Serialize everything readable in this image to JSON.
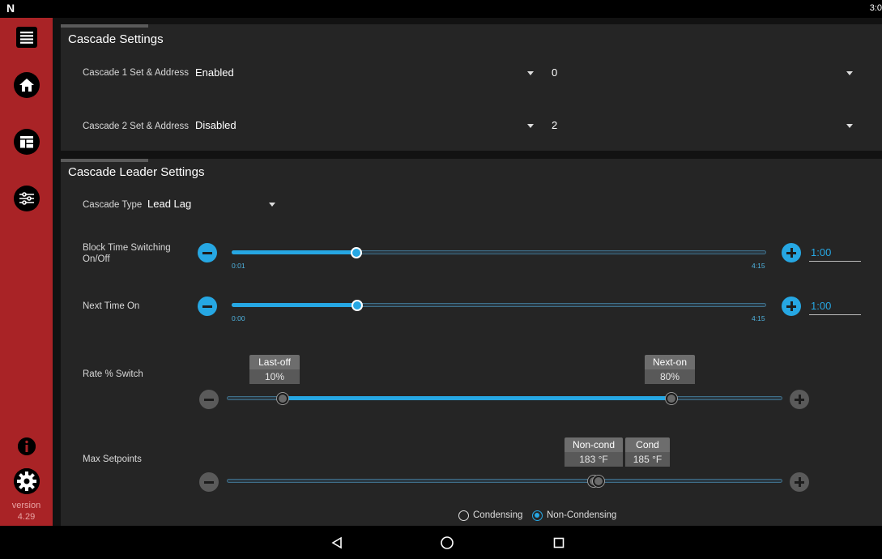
{
  "statusbar": {
    "logo": "N",
    "clock": "3:0"
  },
  "sidebar": {
    "items": [
      {
        "name": "menu",
        "icon": "hamburger-icon"
      },
      {
        "name": "home",
        "icon": "home-icon"
      },
      {
        "name": "dashboard",
        "icon": "dashboard-icon"
      },
      {
        "name": "settings-sliders",
        "icon": "sliders-icon"
      },
      {
        "name": "info",
        "icon": "info-icon"
      },
      {
        "name": "settings",
        "icon": "gear-icon"
      }
    ],
    "version_label": "version",
    "version_number": "4.29"
  },
  "cascade_settings": {
    "title": "Cascade Settings",
    "rows": [
      {
        "label": "Cascade 1 Set & Address",
        "value": "Enabled",
        "address": "0"
      },
      {
        "label": "Cascade 2 Set & Address",
        "value": "Disabled",
        "address": "2"
      }
    ]
  },
  "leader_settings": {
    "title": "Cascade Leader Settings",
    "cascade_type_label": "Cascade Type",
    "cascade_type_value": "Lead Lag",
    "block_time": {
      "label": "Block Time Switching On/Off",
      "min_label": "0:01",
      "max_label": "4:15",
      "value": "1:00",
      "fraction": 0.234
    },
    "next_time": {
      "label": "Next Time On",
      "min_label": "0:00",
      "max_label": "4:15",
      "value": "1:00",
      "fraction": 0.235
    },
    "rate_switch": {
      "label": "Rate % Switch",
      "low_title": "Last-off",
      "low_value": "10%",
      "high_title": "Next-on",
      "high_value": "80%",
      "low_fraction": 0.1,
      "high_fraction": 0.8
    },
    "max_setpoints": {
      "label": "Max Setpoints",
      "low_title": "Non-cond",
      "low_value": "183 °F",
      "high_title": "Cond",
      "high_value": "185 °F"
    },
    "mode": {
      "options": [
        "Condensing",
        "Non-Condensing"
      ],
      "selected": "Non-Condensing"
    }
  },
  "colors": {
    "accent": "#26a7e3",
    "sidebar": "#a92326",
    "card": "#252525"
  }
}
